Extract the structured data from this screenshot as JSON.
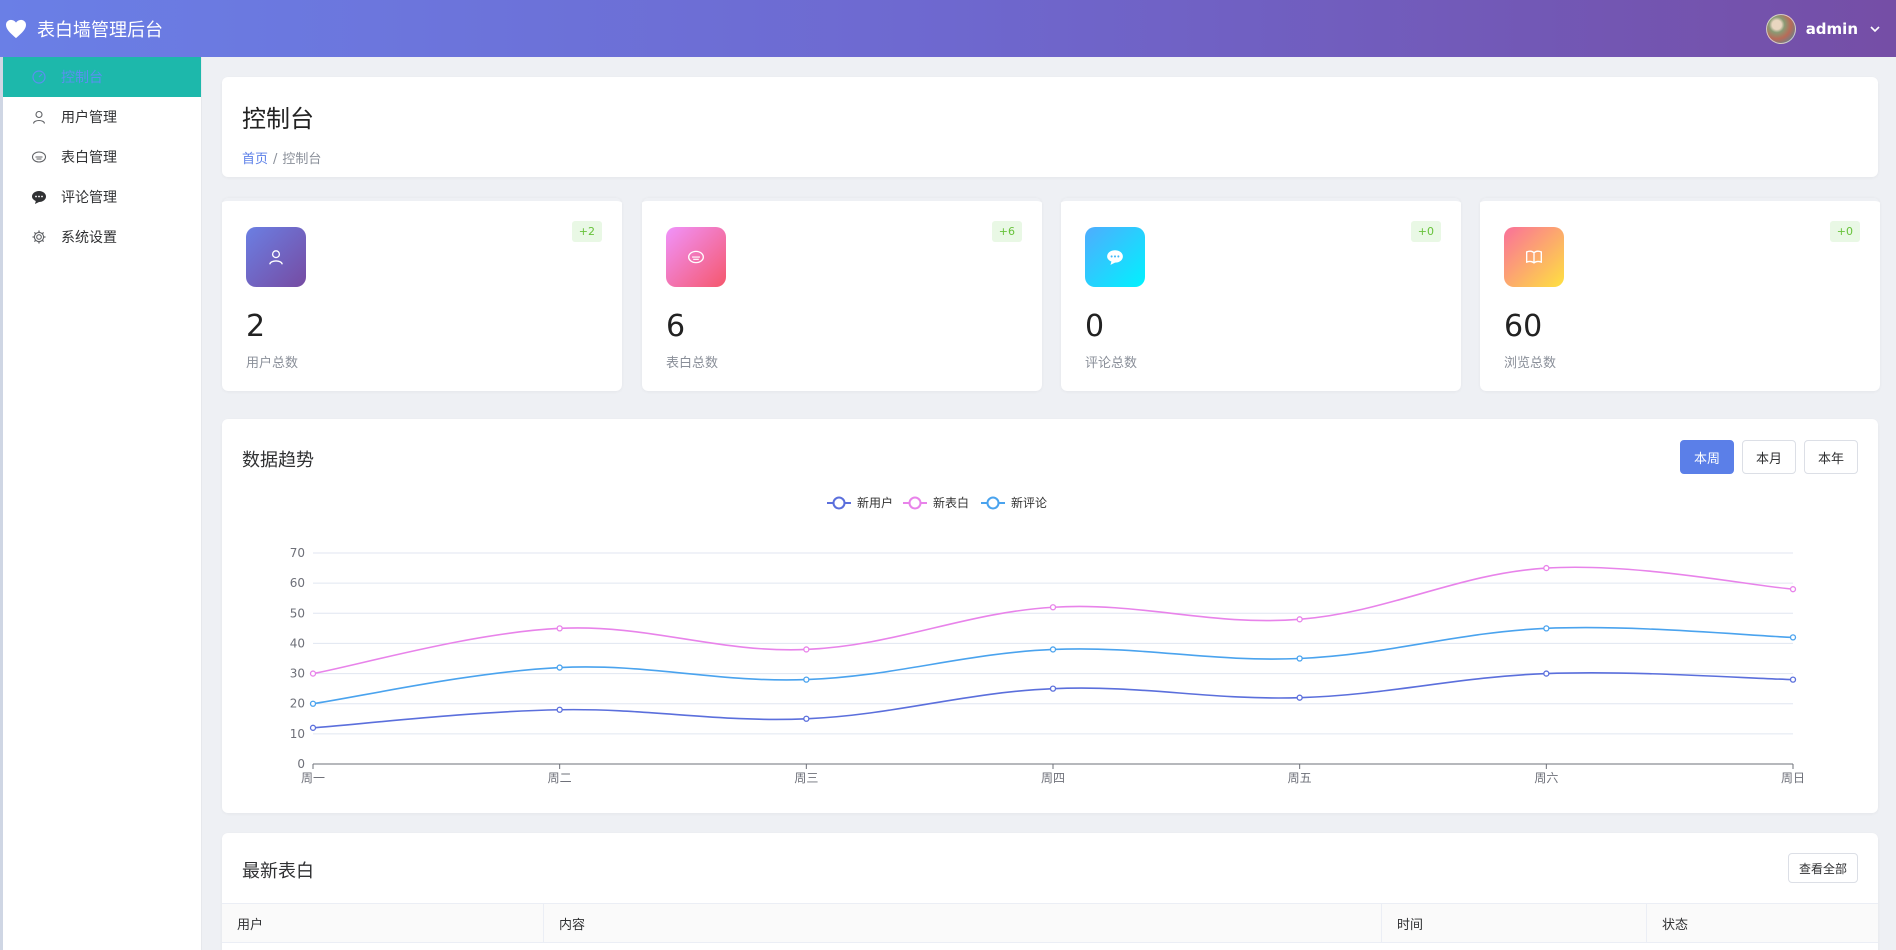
{
  "app": {
    "title": "表白墙管理后台",
    "username": "admin"
  },
  "sidebar": {
    "items": [
      {
        "label": "控制台",
        "icon": "dashboard-icon"
      },
      {
        "label": "用户管理",
        "icon": "user-icon"
      },
      {
        "label": "表白管理",
        "icon": "confession-icon"
      },
      {
        "label": "评论管理",
        "icon": "comment-icon"
      },
      {
        "label": "系统设置",
        "icon": "gear-icon"
      }
    ]
  },
  "page": {
    "title": "控制台",
    "breadcrumb": {
      "home": "首页",
      "separator": "/",
      "current": "控制台"
    }
  },
  "stats": [
    {
      "value": "2",
      "label": "用户总数",
      "badge": "+2",
      "icon": "user-icon"
    },
    {
      "value": "6",
      "label": "表白总数",
      "badge": "+6",
      "icon": "confession-icon"
    },
    {
      "value": "0",
      "label": "评论总数",
      "badge": "+0",
      "icon": "comment-icon"
    },
    {
      "value": "60",
      "label": "浏览总数",
      "badge": "+0",
      "icon": "book-icon"
    }
  ],
  "trend": {
    "title": "数据趋势",
    "ranges": [
      "本周",
      "本月",
      "本年"
    ],
    "active_range": "本周"
  },
  "chart_data": {
    "type": "line",
    "categories": [
      "周一",
      "周二",
      "周三",
      "周四",
      "周五",
      "周六",
      "周日"
    ],
    "ylim": [
      0,
      70
    ],
    "yticks": [
      0,
      10,
      20,
      30,
      40,
      50,
      60,
      70
    ],
    "legend_position": "top-center",
    "grid": true,
    "smooth": true,
    "series": [
      {
        "name": "新用户",
        "color": "#5b6fdc",
        "values": [
          12,
          18,
          15,
          25,
          22,
          30,
          28
        ]
      },
      {
        "name": "新表白",
        "color": "#e883ea",
        "values": [
          30,
          45,
          38,
          52,
          48,
          65,
          58
        ]
      },
      {
        "name": "新评论",
        "color": "#4aa3ee",
        "values": [
          20,
          32,
          28,
          38,
          35,
          45,
          42
        ]
      }
    ]
  },
  "recent": {
    "title": "最新表白",
    "view_all": "查看全部",
    "columns": [
      "用户",
      "内容",
      "时间",
      "状态"
    ]
  }
}
